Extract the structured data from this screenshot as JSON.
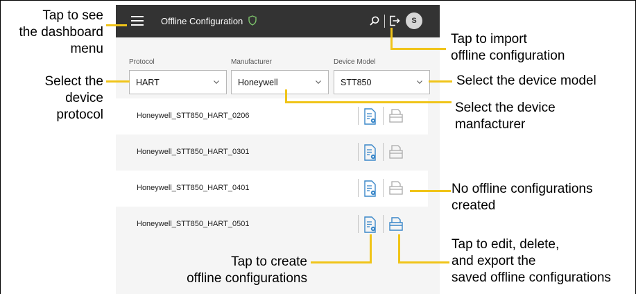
{
  "app": {
    "title": "Offline Configuration",
    "avatar_initial": "S",
    "icons": {
      "menu": "hamburger-icon",
      "status": "shield-icon",
      "search": "search-icon",
      "import": "import-icon",
      "create": "create-config-icon",
      "saved": "saved-config-folder-icon"
    },
    "colors": {
      "topbar": "#333333",
      "accent": "#3a87c9",
      "shield": "#7cc26b",
      "leader": "#f0c419"
    }
  },
  "filters": {
    "protocol": {
      "label": "Protocol",
      "value": "HART"
    },
    "manufacturer": {
      "label": "Manufacturer",
      "value": "Honeywell"
    },
    "device_model": {
      "label": "Device Model",
      "value": "STT850"
    }
  },
  "rows": [
    {
      "name": "Honeywell_STT850_HART_0206",
      "saved_active": false
    },
    {
      "name": "Honeywell_STT850_HART_0301",
      "saved_active": false
    },
    {
      "name": "Honeywell_STT850_HART_0401",
      "saved_active": false
    },
    {
      "name": "Honeywell_STT850_HART_0501",
      "saved_active": true
    }
  ],
  "annotations": {
    "menu": [
      "Tap to see",
      "the dashboard",
      "menu"
    ],
    "protocol": [
      "Select the",
      "device",
      "protocol"
    ],
    "import": [
      "Tap to import",
      "offline configuration"
    ],
    "model": [
      "Select the device model"
    ],
    "manufacturer": [
      "Select the device",
      "manfacturer"
    ],
    "none": [
      "No offline configurations",
      "created"
    ],
    "edit": [
      "Tap to edit, delete,",
      "and export the",
      "saved offline configurations"
    ],
    "create": [
      "Tap to create",
      "offline configurations"
    ]
  }
}
